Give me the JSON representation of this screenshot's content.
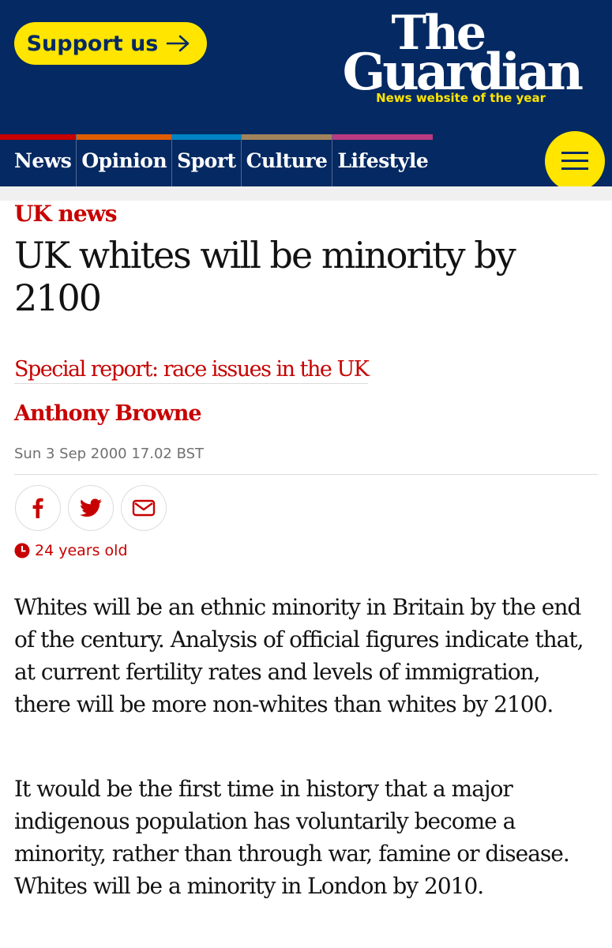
{
  "header": {
    "support_label": "Support us",
    "logo_line1": "The",
    "logo_line2": "Guardian",
    "tagline": "News website of the year",
    "colors": {
      "background": "#052962",
      "accent": "#ffe500"
    }
  },
  "nav": {
    "items": [
      {
        "label": "News",
        "color": "#c70000"
      },
      {
        "label": "Opinion",
        "color": "#e05e00"
      },
      {
        "label": "Sport",
        "color": "#0084c6"
      },
      {
        "label": "Culture",
        "color": "#a1845c"
      },
      {
        "label": "Lifestyle",
        "color": "#bb3b80"
      }
    ],
    "menu_icon": "hamburger-menu-icon"
  },
  "article": {
    "kicker": "UK news",
    "headline": "UK whites will be minority by 2100",
    "series": "Special report: race issues in the UK",
    "author": "Anthony Browne",
    "date": "Sun 3 Sep 2000 17.02 BST",
    "share_icons": [
      "facebook-icon",
      "twitter-icon",
      "email-icon"
    ],
    "age_label": "24 years old",
    "paragraphs": [
      "Whites will be an ethnic minority in Britain by the end of the century. Analysis of official figures indicate that, at current fertility rates and levels of immigration, there will be more non-whites than whites by 2100.",
      "It would be the first time in history that a major indigenous population has voluntarily become a minority, rather than through war, famine or disease. Whites will be a minority in London by 2010."
    ],
    "accent_color": "#c70000"
  }
}
